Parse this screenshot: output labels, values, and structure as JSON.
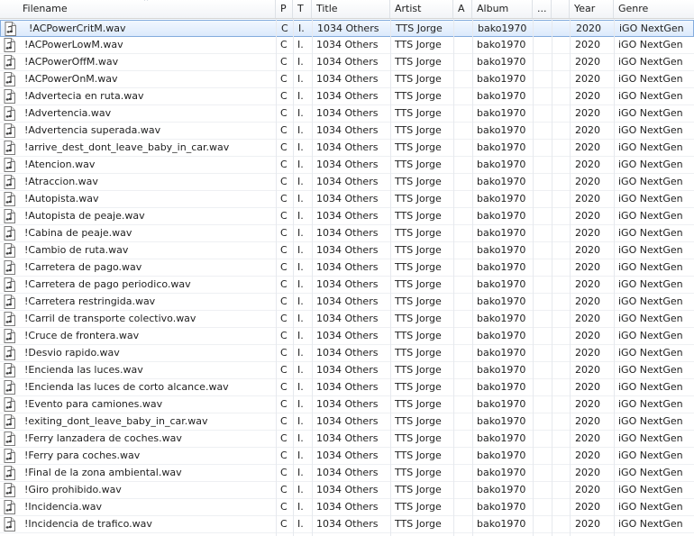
{
  "columns": {
    "filename": "Filename",
    "p": "P",
    "t": "T",
    "title": "Title",
    "artist": "Artist",
    "a": "A",
    "album": "Album",
    "more": "...",
    "year": "Year",
    "genre": "Genre"
  },
  "sort_indicator": "^",
  "rows": [
    {
      "filename": "!ACPowerCritM.wav",
      "p": "C",
      "t": "I.",
      "title": "1034 Others",
      "artist": "TTS Jorge",
      "album": "bako1970",
      "year": "2020",
      "genre": "iGO NextGen",
      "selected": true
    },
    {
      "filename": "!ACPowerLowM.wav",
      "p": "C",
      "t": "I.",
      "title": "1034 Others",
      "artist": "TTS Jorge",
      "album": "bako1970",
      "year": "2020",
      "genre": "iGO NextGen"
    },
    {
      "filename": "!ACPowerOffM.wav",
      "p": "C",
      "t": "I.",
      "title": "1034 Others",
      "artist": "TTS Jorge",
      "album": "bako1970",
      "year": "2020",
      "genre": "iGO NextGen"
    },
    {
      "filename": "!ACPowerOnM.wav",
      "p": "C",
      "t": "I.",
      "title": "1034 Others",
      "artist": "TTS Jorge",
      "album": "bako1970",
      "year": "2020",
      "genre": "iGO NextGen"
    },
    {
      "filename": "!Advertecia en ruta.wav",
      "p": "C",
      "t": "I.",
      "title": "1034 Others",
      "artist": "TTS Jorge",
      "album": "bako1970",
      "year": "2020",
      "genre": "iGO NextGen"
    },
    {
      "filename": "!Advertencia.wav",
      "p": "C",
      "t": "I.",
      "title": "1034 Others",
      "artist": "TTS Jorge",
      "album": "bako1970",
      "year": "2020",
      "genre": "iGO NextGen"
    },
    {
      "filename": "!Advertencia superada.wav",
      "p": "C",
      "t": "I.",
      "title": "1034 Others",
      "artist": "TTS Jorge",
      "album": "bako1970",
      "year": "2020",
      "genre": "iGO NextGen"
    },
    {
      "filename": "!arrive_dest_dont_leave_baby_in_car.wav",
      "p": "C",
      "t": "I.",
      "title": "1034 Others",
      "artist": "TTS Jorge",
      "album": "bako1970",
      "year": "2020",
      "genre": "iGO NextGen"
    },
    {
      "filename": "!Atencion.wav",
      "p": "C",
      "t": "I.",
      "title": "1034 Others",
      "artist": "TTS Jorge",
      "album": "bako1970",
      "year": "2020",
      "genre": "iGO NextGen"
    },
    {
      "filename": "!Atraccion.wav",
      "p": "C",
      "t": "I.",
      "title": "1034 Others",
      "artist": "TTS Jorge",
      "album": "bako1970",
      "year": "2020",
      "genre": "iGO NextGen"
    },
    {
      "filename": "!Autopista.wav",
      "p": "C",
      "t": "I.",
      "title": "1034 Others",
      "artist": "TTS Jorge",
      "album": "bako1970",
      "year": "2020",
      "genre": "iGO NextGen"
    },
    {
      "filename": "!Autopista de peaje.wav",
      "p": "C",
      "t": "I.",
      "title": "1034 Others",
      "artist": "TTS Jorge",
      "album": "bako1970",
      "year": "2020",
      "genre": "iGO NextGen"
    },
    {
      "filename": "!Cabina de peaje.wav",
      "p": "C",
      "t": "I.",
      "title": "1034 Others",
      "artist": "TTS Jorge",
      "album": "bako1970",
      "year": "2020",
      "genre": "iGO NextGen"
    },
    {
      "filename": "!Cambio de ruta.wav",
      "p": "C",
      "t": "I.",
      "title": "1034 Others",
      "artist": "TTS Jorge",
      "album": "bako1970",
      "year": "2020",
      "genre": "iGO NextGen"
    },
    {
      "filename": "!Carretera de pago.wav",
      "p": "C",
      "t": "I.",
      "title": "1034 Others",
      "artist": "TTS Jorge",
      "album": "bako1970",
      "year": "2020",
      "genre": "iGO NextGen"
    },
    {
      "filename": "!Carretera de pago periodico.wav",
      "p": "C",
      "t": "I.",
      "title": "1034 Others",
      "artist": "TTS Jorge",
      "album": "bako1970",
      "year": "2020",
      "genre": "iGO NextGen"
    },
    {
      "filename": "!Carretera restringida.wav",
      "p": "C",
      "t": "I.",
      "title": "1034 Others",
      "artist": "TTS Jorge",
      "album": "bako1970",
      "year": "2020",
      "genre": "iGO NextGen"
    },
    {
      "filename": "!Carril de transporte colectivo.wav",
      "p": "C",
      "t": "I.",
      "title": "1034 Others",
      "artist": "TTS Jorge",
      "album": "bako1970",
      "year": "2020",
      "genre": "iGO NextGen"
    },
    {
      "filename": "!Cruce de frontera.wav",
      "p": "C",
      "t": "I.",
      "title": "1034 Others",
      "artist": "TTS Jorge",
      "album": "bako1970",
      "year": "2020",
      "genre": "iGO NextGen"
    },
    {
      "filename": "!Desvio rapido.wav",
      "p": "C",
      "t": "I.",
      "title": "1034 Others",
      "artist": "TTS Jorge",
      "album": "bako1970",
      "year": "2020",
      "genre": "iGO NextGen"
    },
    {
      "filename": "!Encienda las luces.wav",
      "p": "C",
      "t": "I.",
      "title": "1034 Others",
      "artist": "TTS Jorge",
      "album": "bako1970",
      "year": "2020",
      "genre": "iGO NextGen"
    },
    {
      "filename": "!Encienda las luces de corto alcance.wav",
      "p": "C",
      "t": "I.",
      "title": "1034 Others",
      "artist": "TTS Jorge",
      "album": "bako1970",
      "year": "2020",
      "genre": "iGO NextGen"
    },
    {
      "filename": "!Evento para camiones.wav",
      "p": "C",
      "t": "I.",
      "title": "1034 Others",
      "artist": "TTS Jorge",
      "album": "bako1970",
      "year": "2020",
      "genre": "iGO NextGen"
    },
    {
      "filename": "!exiting_dont_leave_baby_in_car.wav",
      "p": "C",
      "t": "I.",
      "title": "1034 Others",
      "artist": "TTS Jorge",
      "album": "bako1970",
      "year": "2020",
      "genre": "iGO NextGen"
    },
    {
      "filename": "!Ferry lanzadera de coches.wav",
      "p": "C",
      "t": "I.",
      "title": "1034 Others",
      "artist": "TTS Jorge",
      "album": "bako1970",
      "year": "2020",
      "genre": "iGO NextGen"
    },
    {
      "filename": "!Ferry para coches.wav",
      "p": "C",
      "t": "I.",
      "title": "1034 Others",
      "artist": "TTS Jorge",
      "album": "bako1970",
      "year": "2020",
      "genre": "iGO NextGen"
    },
    {
      "filename": "!Final de la zona ambiental.wav",
      "p": "C",
      "t": "I.",
      "title": "1034 Others",
      "artist": "TTS Jorge",
      "album": "bako1970",
      "year": "2020",
      "genre": "iGO NextGen"
    },
    {
      "filename": "!Giro prohibido.wav",
      "p": "C",
      "t": "I.",
      "title": "1034 Others",
      "artist": "TTS Jorge",
      "album": "bako1970",
      "year": "2020",
      "genre": "iGO NextGen"
    },
    {
      "filename": "!Incidencia.wav",
      "p": "C",
      "t": "I.",
      "title": "1034 Others",
      "artist": "TTS Jorge",
      "album": "bako1970",
      "year": "2020",
      "genre": "iGO NextGen"
    },
    {
      "filename": "!Incidencia de trafico.wav",
      "p": "C",
      "t": "I.",
      "title": "1034 Others",
      "artist": "TTS Jorge",
      "album": "bako1970",
      "year": "2020",
      "genre": "iGO NextGen"
    }
  ],
  "icons": {
    "file": "audio-file-icon"
  },
  "colors": {
    "selected_border": "#84acdd",
    "selected_fill": "#dceafc",
    "header_border": "#d5d5d5"
  }
}
